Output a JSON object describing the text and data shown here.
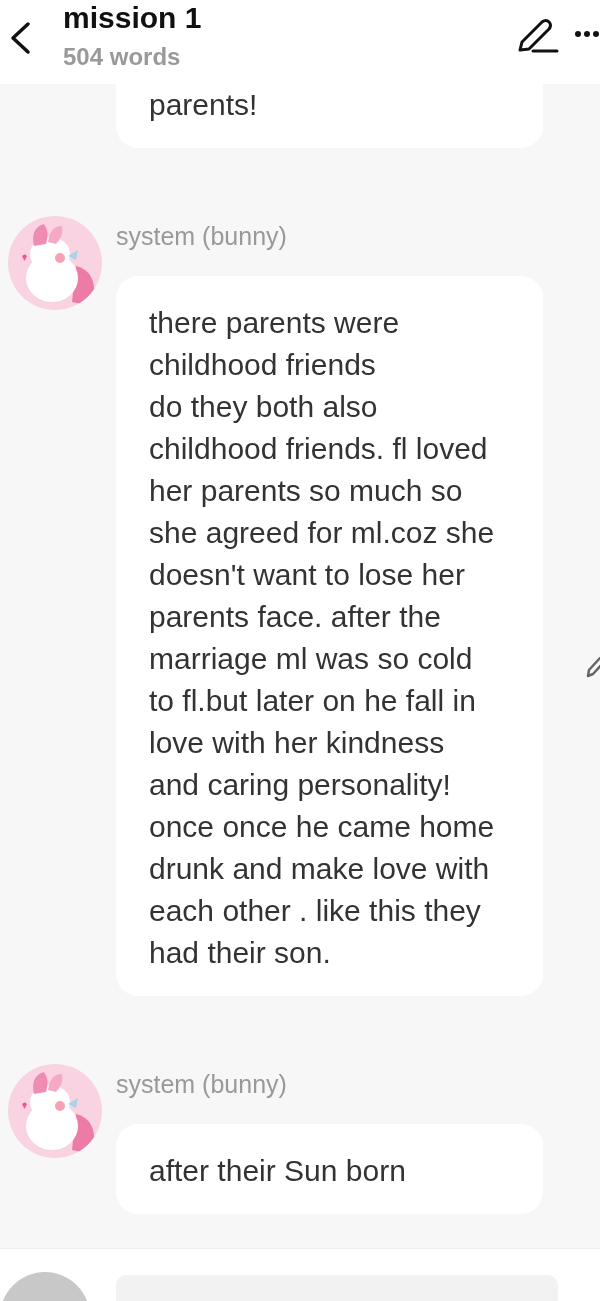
{
  "header": {
    "title": "mission 1",
    "subtitle": "504 words"
  },
  "messages": [
    {
      "kind": "continued",
      "text": "parents!"
    },
    {
      "kind": "message",
      "sender": "system (bunny)",
      "text": "there parents were childhood friends\ndo they both also childhood friends. fl loved her parents so much so she agreed for ml.coz she doesn't want to lose her parents face. after the marriage ml was so cold to fl.but later on he fall in love with her kindness and caring personality! once once he came home drunk and make love with each other . like this they had their son."
    },
    {
      "kind": "message",
      "sender": "system (bunny)",
      "text": "after their Sun born"
    }
  ]
}
